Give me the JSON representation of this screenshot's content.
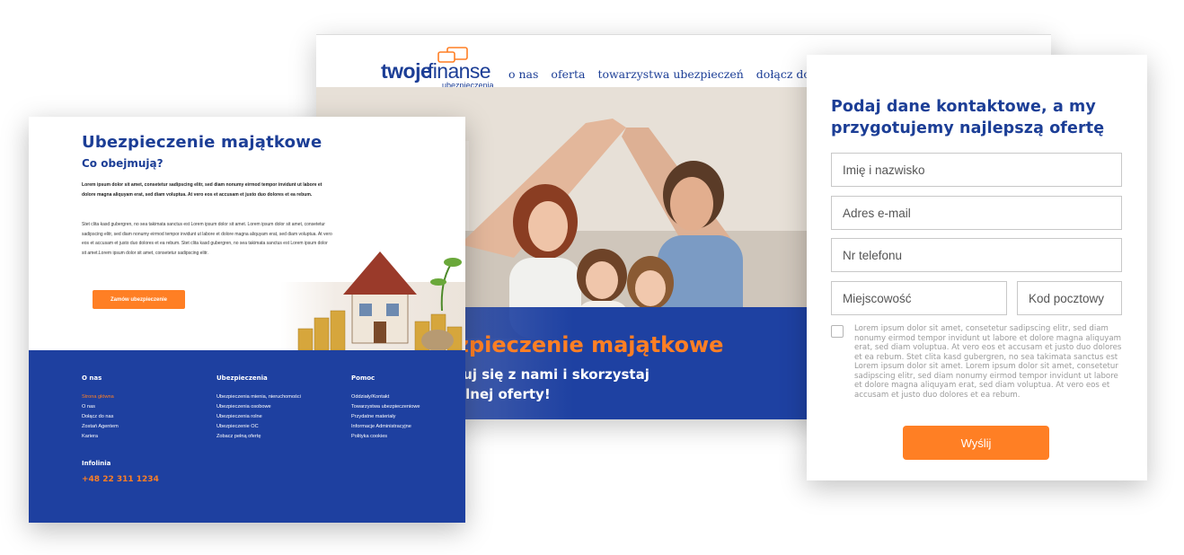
{
  "colors": {
    "brand_blue": "#1c3e96",
    "footer_blue": "#1e40a0",
    "accent_orange": "#ff7f24"
  },
  "home": {
    "logo": {
      "strong": "twoje",
      "light": "finanse",
      "sub": "ubezpieczenia"
    },
    "nav": [
      "o nas",
      "oferta",
      "towarzystwa ubezpieczeń",
      "dołącz do nas"
    ],
    "hero_title": "zpieczenie majątkowe",
    "hero_sub_line1": "tuj się z nami i skorzystaj",
    "hero_sub_line2": "alnej oferty!"
  },
  "product": {
    "title": "Ubezpieczenie majątkowe",
    "subtitle": "Co obejmują?",
    "lead": "Lorem ipsum dolor sit amet, consetetur sadipscing elitr, sed diam nonumy eirmod tempor invidunt ut labore et dolore magna aliquyam erat, sed diam voluptua. At vero eos et accusam et justo duo dolores et ea rebum.",
    "body": "Stet clita kasd gubergren, no sea takimata sanctus est Lorem ipsum dolor sit amet. Lorem ipsum dolor sit amet, consetetur sadipscing elitr, sed diam nonumy eirmod tempor invidunt ut labore et dolore magna aliquyam erat, sed diam voluptua. At vero eos et accusam et justo duo dolores et ea rebum. Stet clita kasd gubergren, no sea takimata sanctus est Lorem ipsum dolor sit amet.Lorem ipsum dolor sit amet, consetetur sadipscing elitr.",
    "cta": "Zamów ubezpieczenie"
  },
  "footer": {
    "columns": [
      {
        "heading": "O nas",
        "items": [
          "Strona główna",
          "O nas",
          "Dołącz do nas",
          "Zostań Agentem",
          "Kariera"
        ]
      },
      {
        "heading": "Ubezpieczenia",
        "items": [
          "Ubezpieczenia mienia, nieruchomości",
          "Ubezpieczenia osobowe",
          "Ubezpieczenia rolne",
          "Ubezpieczenie OC",
          "Zobacz pełną ofertę"
        ]
      },
      {
        "heading": "Pomoc",
        "items": [
          "Oddziały/Kontakt",
          "Towarzystwa ubezpieczeniowe",
          "Przydatne materiały",
          "Informacje Administracyjne",
          "Polityka cookies"
        ]
      }
    ],
    "infolinia_label": "Infolinia",
    "phone": "+48 22 311 1234"
  },
  "form": {
    "title": "Podaj dane kontaktowe, a my przygotujemy najlepszą ofertę",
    "name_placeholder": "Imię i nazwisko",
    "email_placeholder": "Adres e-mail",
    "phone_placeholder": "Nr telefonu",
    "city_placeholder": "Miejscowość",
    "zip_placeholder": "Kod pocztowy",
    "consent": "Lorem ipsum dolor sit amet, consetetur sadipscing elitr, sed diam nonumy eirmod tempor invidunt ut labore et dolore magna aliquyam erat, sed diam voluptua. At vero eos et accusam et justo duo dolores et ea rebum. Stet clita kasd gubergren, no sea takimata sanctus est Lorem ipsum dolor sit amet. Lorem ipsum dolor sit amet, consetetur sadipscing elitr, sed diam nonumy eirmod tempor invidunt ut labore et dolore magna aliquyam erat, sed diam voluptua. At vero eos et accusam et justo duo dolores et ea rebum.",
    "submit": "Wyślij"
  }
}
